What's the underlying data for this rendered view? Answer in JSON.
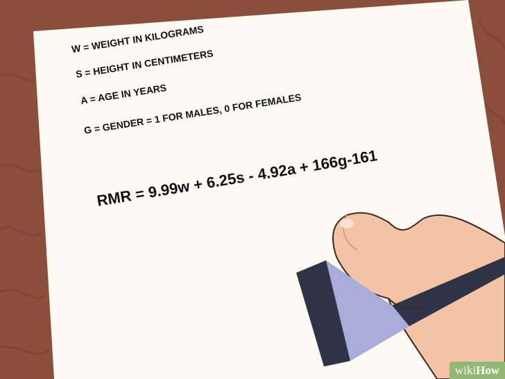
{
  "notes": {
    "lines": [
      "W = WEIGHT IN KILOGRAMS",
      "S = HEIGHT IN CENTIMETERS",
      "A = AGE IN YEARS",
      "G = GENDER = 1 FOR MALES, 0 FOR FEMALES"
    ],
    "formula": "RMR = 9.99w + 6.25s - 4.92a + 166g-161"
  },
  "watermark": {
    "wiki": "wiki",
    "how": "How"
  },
  "colors": {
    "wood": "#8a4e3b",
    "paper": "#fdfaf3",
    "skin": "#f4c3a6",
    "pen": "#2e3446",
    "pen_grip": "#a8acd8",
    "badge": "#93b874"
  }
}
